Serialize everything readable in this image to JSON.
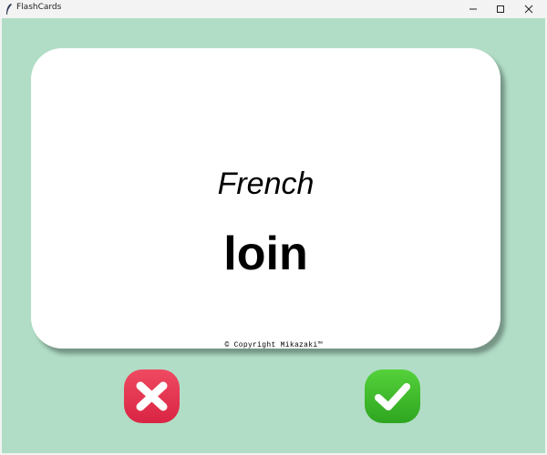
{
  "window": {
    "title": "FlashCards"
  },
  "card": {
    "language": "French",
    "word": "loin"
  },
  "footer": {
    "copyright": "© Copyright Mikazaki™"
  },
  "buttons": {
    "wrong": {
      "icon": "cross-icon",
      "color": "#e8344f"
    },
    "right": {
      "icon": "check-icon",
      "color": "#3fbe2a"
    }
  },
  "colors": {
    "background": "#b1ddc6",
    "card": "#ffffff"
  }
}
